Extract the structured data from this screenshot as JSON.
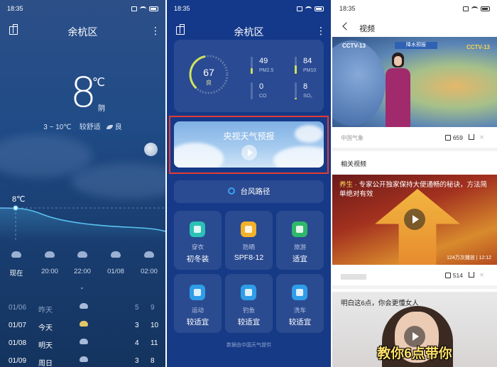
{
  "panel1": {
    "time": "18:35",
    "city": "余杭区",
    "temp": "8",
    "unit": "℃",
    "condition": "阴",
    "range": "3 ~ 10℃",
    "comfort": "较舒适",
    "aqi": "良",
    "curve_label": "8℃",
    "hours": [
      "现在",
      "20:00",
      "22:00",
      "01/08",
      "02:00"
    ],
    "days": [
      {
        "date": "01/06",
        "name": "昨天",
        "lo": "5",
        "hi": "9"
      },
      {
        "date": "01/07",
        "name": "今天",
        "lo": "3",
        "hi": "10"
      },
      {
        "date": "01/08",
        "name": "明天",
        "lo": "4",
        "hi": "11"
      },
      {
        "date": "01/09",
        "name": "周日",
        "lo": "3",
        "hi": "8"
      }
    ]
  },
  "panel2": {
    "time": "18:35",
    "city": "余杭区",
    "aqi_value": "67",
    "aqi_label": "良",
    "aqi_level": 0.45,
    "pollutants": [
      {
        "key": "PM2.5",
        "value": "49",
        "level": 0.35
      },
      {
        "key": "PM10",
        "value": "84",
        "level": 0.5
      },
      {
        "key": "CO",
        "value": "0",
        "level": 0.0
      },
      {
        "key": "SO₂",
        "value": "8",
        "level": 0.1
      }
    ],
    "video_title": "央视天气预报",
    "typhoon": "台风路径",
    "tiles": [
      {
        "icon": "clothes-icon",
        "title": "穿衣",
        "value": "初冬装",
        "color": "#2bc1b6"
      },
      {
        "icon": "sun-protection-icon",
        "title": "防晒",
        "value": "SPF8-12",
        "color": "#f2b12b"
      },
      {
        "icon": "travel-icon",
        "title": "旅游",
        "value": "适宜",
        "color": "#2fb86a"
      },
      {
        "icon": "sport-icon",
        "title": "运动",
        "value": "较适宜",
        "color": "#2f9de8"
      },
      {
        "icon": "fishing-icon",
        "title": "钓鱼",
        "value": "较适宜",
        "color": "#2f9de8"
      },
      {
        "icon": "car-wash-icon",
        "title": "洗车",
        "value": "较适宜",
        "color": "#2f9de8"
      }
    ],
    "footnote": "数据由中国天气提供"
  },
  "panel3": {
    "time": "18:35",
    "header": "视频",
    "cctv": "CCTV-13",
    "banner": "降水预报",
    "cctv_r": "CCTV-13",
    "source": "中国气象",
    "likes1": "659",
    "related": "相关视频",
    "rel1_caption_prefix": "养生",
    "rel1_caption": "专家公开独家保持大便通畅的秘诀，方法简单绝对有效",
    "rel1_views": "124万次播放 | 12:12",
    "likes2": "514",
    "rel2_caption": "明白这6点，你会更懂女人",
    "rel2_subtitle": "教你6点带你"
  }
}
